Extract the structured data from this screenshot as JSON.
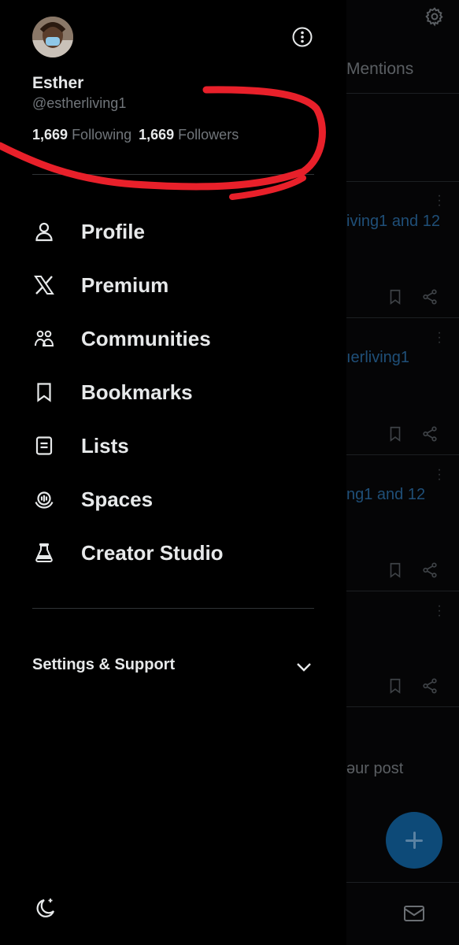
{
  "profile": {
    "name": "Esther",
    "handle": "@estherliving1",
    "following_count": "1,669",
    "following_label": "Following",
    "followers_count": "1,669",
    "followers_label": "Followers"
  },
  "menu": {
    "items": [
      {
        "label": "Profile",
        "icon": "person-icon"
      },
      {
        "label": "Premium",
        "icon": "x-logo-icon"
      },
      {
        "label": "Communities",
        "icon": "communities-icon"
      },
      {
        "label": "Bookmarks",
        "icon": "bookmark-icon"
      },
      {
        "label": "Lists",
        "icon": "list-icon"
      },
      {
        "label": "Spaces",
        "icon": "spaces-icon"
      },
      {
        "label": "Creator Studio",
        "icon": "creator-studio-icon"
      }
    ],
    "settings_label": "Settings & Support"
  },
  "background": {
    "tab": "Mentions",
    "snippets": [
      "iving1 and 12",
      "ıerliving1",
      "ng1 and 12",
      "əur post"
    ]
  },
  "colors": {
    "background": "#000000",
    "text": "#e7e9ea",
    "muted": "#71767b",
    "accent": "#1d9bf0",
    "annotation": "#e8202a"
  }
}
